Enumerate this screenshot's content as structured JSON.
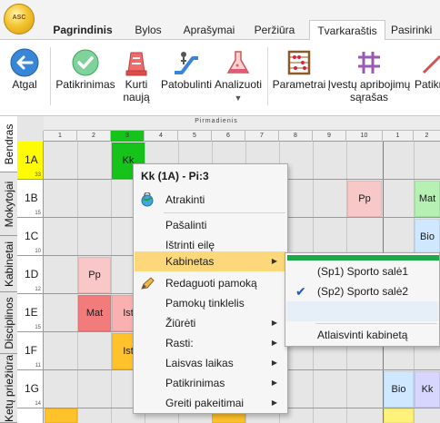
{
  "app": {
    "orb_label": "ASC"
  },
  "tabs": [
    "Pagrindinis",
    "Bylos",
    "Aprašymai",
    "Peržiūra",
    "Tvarkaraštis",
    "Pasirinki"
  ],
  "ribbon": {
    "back": "Atgal",
    "check": "Patikrinimas",
    "create_new": [
      "Kurti",
      "naują"
    ],
    "improve": "Patobulinti",
    "analyze": "Analizuoti",
    "parameters": "Parametrai",
    "constraints": [
      "Įvestų apribojimų",
      "sąrašas"
    ],
    "check_cut": "Patikri"
  },
  "side_tabs": [
    "Bendras",
    "Mokytojai",
    "Kabinetai",
    "Disciplinos",
    "Ketų priežiūra"
  ],
  "grid": {
    "day_label": "Pirmadienis",
    "periods": [
      "1",
      "2",
      "3",
      "4",
      "5",
      "6",
      "7",
      "8",
      "9",
      "10",
      "1",
      "2"
    ],
    "rows": [
      {
        "class": "1A",
        "count": "33"
      },
      {
        "class": "1B",
        "count": "15"
      },
      {
        "class": "1C",
        "count": "10"
      },
      {
        "class": "1D",
        "count": "12"
      },
      {
        "class": "1E",
        "count": "15"
      },
      {
        "class": "1F",
        "count": "11"
      },
      {
        "class": "1G",
        "count": "14"
      }
    ],
    "lessons": {
      "kk": "Kk",
      "pp_1b": "Pp",
      "mat_1b": "Mat",
      "bio_1c": "Bio",
      "pp_1d": "Pp",
      "mat_1e": "Mat",
      "ist_1e": "Ist",
      "ist_1f": "Ist",
      "bio_1g": "Bio",
      "kk_1g": "Kk"
    }
  },
  "context_menu": {
    "title": "Kk (1A) - Pi:3",
    "items": {
      "unlock": "Atrakinti",
      "remove": "Pašalinti",
      "delete_row": "Ištrinti eilę",
      "rooms": "Kabinetas",
      "edit_lesson": "Redaguoti pamoką",
      "lesson_grid": "Pamokų tinklelis",
      "view": "Žiūrėti",
      "find": "Rasti:",
      "free_time": "Laisvas laikas",
      "checks": "Patikrinimas",
      "quick_changes": "Greiti pakeitimai"
    }
  },
  "submenu": {
    "room1": "(Sp1) Sporto salė1",
    "room2": "(Sp2) Sporto salė2",
    "free_room": "Atlaisvinti kabinetą"
  },
  "colors": {
    "selected_row": "#fffb00",
    "lesson_green": "#16c31a",
    "lesson_pink": "#f8c7c7",
    "lesson_red": "#f27b7b",
    "lesson_light_red": "#f9b0b0",
    "lesson_orange": "#ffc22a",
    "lesson_light_green": "#b6f0b3",
    "lesson_blue": "#cfe8ff",
    "lesson_lavender": "#d6d6ff",
    "menu_highlight": "#fcd87a",
    "submenu_bar": "#1fa84a"
  }
}
